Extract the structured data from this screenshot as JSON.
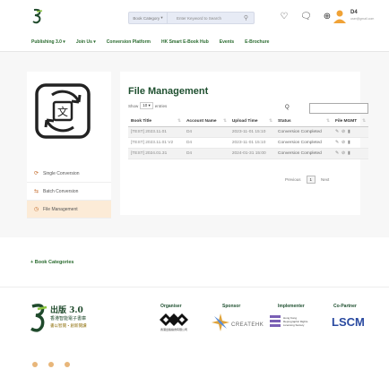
{
  "header": {
    "book_category": "Book Category",
    "search_placeholder": "Enter Keyword to Search",
    "user_name": "D4",
    "user_email": "user@gmail.com"
  },
  "nav": [
    "Publishing 3.0",
    "Join Us",
    "Conversion Platform",
    "HK Smart E-Book Hub",
    "Events",
    "E-Brochure"
  ],
  "sidebar": {
    "items": [
      {
        "label": "Single Conversion",
        "active": false
      },
      {
        "label": "Batch Conversion",
        "active": false
      },
      {
        "label": "File Management",
        "active": true
      }
    ]
  },
  "main": {
    "title": "File Management",
    "show_label": "Show",
    "entries_value": "10",
    "entries_label": "entries",
    "search_label": "Q",
    "columns": [
      "Book Title",
      "Account Name",
      "Upload Time",
      "Status",
      "File MGMT"
    ],
    "rows": [
      {
        "title": "[TEST] 2023.11.01",
        "account": "D4",
        "time": "2023-11-01 15:10",
        "status": "Conversion Completed"
      },
      {
        "title": "[TEST] 2023.11.01 V2",
        "account": "D4",
        "time": "2023-11-01 15:10",
        "status": "Conversion Completed"
      },
      {
        "title": "[TEST] 2024.01.31",
        "account": "D4",
        "time": "2024-01-31 15:00",
        "status": "Conversion Completed"
      }
    ],
    "mgmt_icons": "✎ ⌧ 🗑",
    "pager": {
      "previous": "Previous",
      "page": "1",
      "next": "Next"
    }
  },
  "book_categories": "+ Book Categories",
  "footer": {
    "logo_text_1": "出版 3.0",
    "logo_text_2": "香港智能電子書庫",
    "logo_text_3": "書以智閱・創新閱讀",
    "organiser": "Organiser",
    "sponsor": "Sponsor",
    "implementer": "Implementer",
    "co_partner": "Co-Partner",
    "org_text": "香港出版總會有限公司",
    "creat_text": "CREATEHK",
    "impl_text": "Hong Kong Reprographic Rights Licensing Society",
    "lsm_text": "LSCM"
  }
}
